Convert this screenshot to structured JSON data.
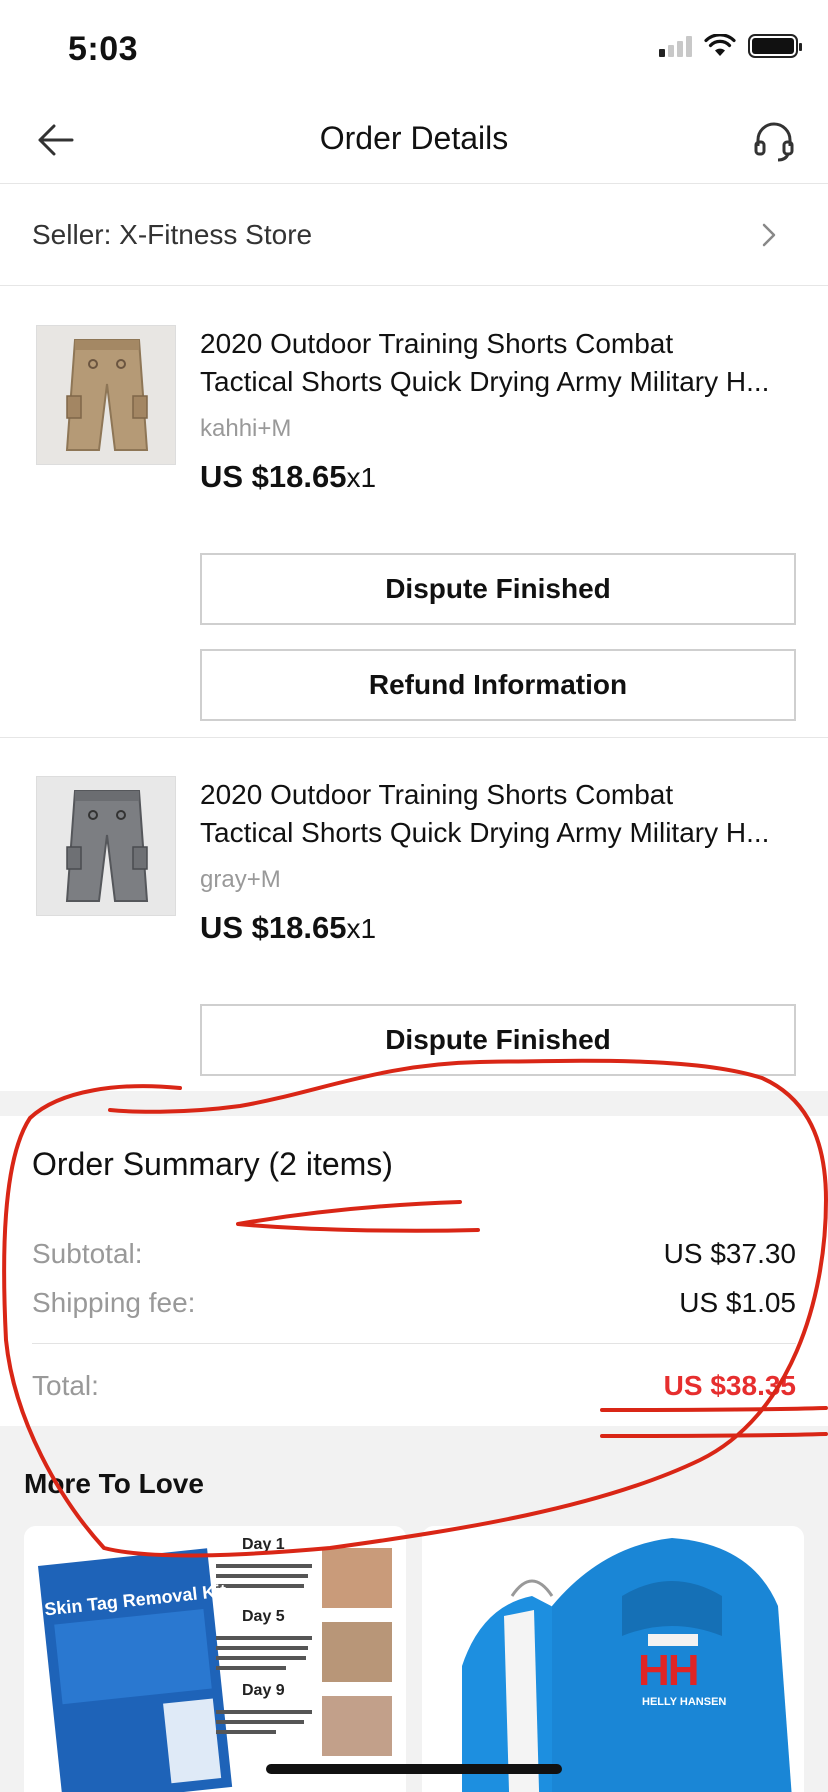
{
  "status_bar": {
    "time": "5:03"
  },
  "nav": {
    "title": "Order Details",
    "back_icon": "arrow-left-icon",
    "support_icon": "headset-icon"
  },
  "seller": {
    "label": "Seller: X-Fitness Store"
  },
  "products": [
    {
      "title_line1": "2020 Outdoor Training Shorts Combat",
      "title_line2": "Tactical Shorts Quick Drying Army Military H...",
      "variant": "kahhi+M",
      "price": "US $18.65",
      "qty": "x1",
      "buttons": [
        "Dispute Finished",
        "Refund Information"
      ]
    },
    {
      "title_line1": "2020 Outdoor Training Shorts Combat",
      "title_line2": "Tactical Shorts Quick Drying Army Military H...",
      "variant": "gray+M",
      "price": "US $18.65",
      "qty": "x1",
      "buttons": [
        "Dispute Finished"
      ]
    }
  ],
  "summary": {
    "title": "Order Summary (2 items)",
    "subtotal_label": "Subtotal:",
    "subtotal_value": "US $37.30",
    "shipping_label": "Shipping fee:",
    "shipping_value": "US $1.05",
    "total_label": "Total:",
    "total_value": "US $38.35"
  },
  "more": {
    "title": "More To Love",
    "card1": {
      "kit_label": "Skin Tag Removal Kit",
      "day1": "Day 1",
      "day5": "Day 5",
      "day9": "Day 9"
    },
    "card2": {
      "brand_logo": "HH",
      "brand_name": "HELLY HANSEN"
    }
  },
  "colors": {
    "price_red": "#e62e2e",
    "annotation_red": "#d92616",
    "jacket_blue": "#1d8fe0"
  }
}
